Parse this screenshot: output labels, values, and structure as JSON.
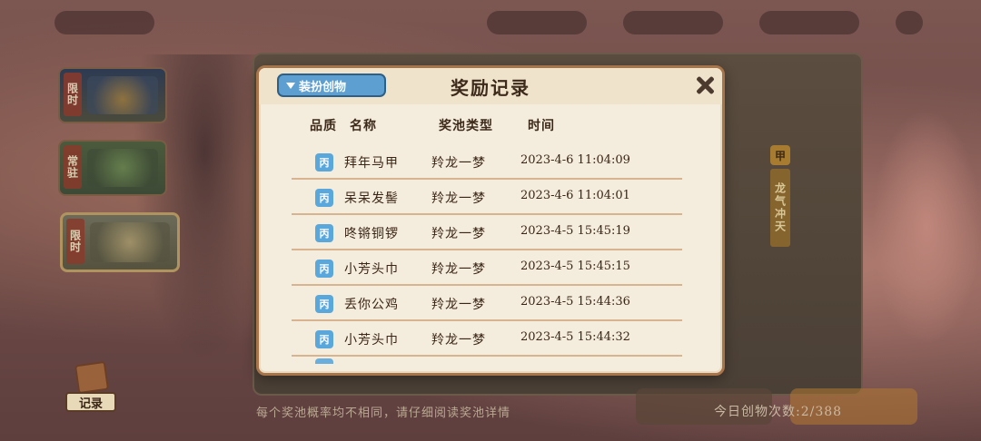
{
  "sidebar": {
    "tabs": [
      {
        "badge": "限时"
      },
      {
        "badge": "常驻"
      },
      {
        "badge": "限时"
      }
    ],
    "record_label": "记录"
  },
  "underlying": {
    "seal_text": "甲",
    "banner_text": "龙气冲天",
    "footer_note": "每个奖池概率均不相同，请仔细阅读奖池详情",
    "footer_count": "今日创物次数:2/388"
  },
  "modal": {
    "title": "奖励记录",
    "filter_label": "装扮创物",
    "columns": {
      "quality": "品质",
      "name": "名称",
      "pool": "奖池类型",
      "time": "时间"
    },
    "rows": [
      {
        "quality": "丙",
        "name": "拜年马甲",
        "pool": "羚龙一梦",
        "time": "2023-4-6  11:04:09"
      },
      {
        "quality": "丙",
        "name": "呆呆发髻",
        "pool": "羚龙一梦",
        "time": "2023-4-6  11:04:01"
      },
      {
        "quality": "丙",
        "name": "咚锵铜锣",
        "pool": "羚龙一梦",
        "time": "2023-4-5  15:45:19"
      },
      {
        "quality": "丙",
        "name": "小芳头巾",
        "pool": "羚龙一梦",
        "time": "2023-4-5  15:45:15"
      },
      {
        "quality": "丙",
        "name": "丢你公鸡",
        "pool": "羚龙一梦",
        "time": "2023-4-5  15:44:36"
      },
      {
        "quality": "丙",
        "name": "小芳头巾",
        "pool": "羚龙一梦",
        "time": "2023-4-5  15:44:32"
      }
    ]
  },
  "colors": {
    "modal_bg": "#f4ecdc",
    "modal_border": "#a8744a",
    "filter_blue": "#5c9fd0",
    "quality_bing_blue": "#5aa7dc",
    "row_divider": "#d8b38f"
  }
}
